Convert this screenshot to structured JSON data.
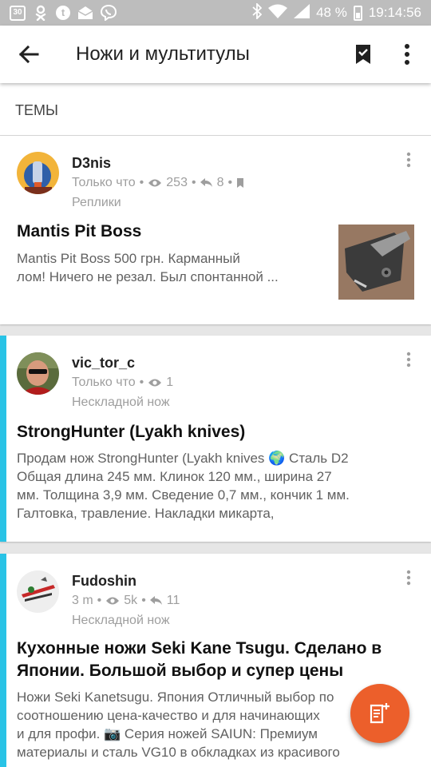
{
  "status_bar": {
    "calendar_day": "30",
    "battery": "48 %",
    "time": "19:14:56",
    "icons": [
      "calendar-icon",
      "ok-icon",
      "t-icon",
      "mail-icon",
      "viber-icon",
      "bluetooth-icon",
      "wifi-icon",
      "signal-icon",
      "battery-icon"
    ]
  },
  "appbar": {
    "title": "Ножи и мультитулы",
    "icons": [
      "back-arrow-icon",
      "bookmark-icon",
      "more-vert-icon"
    ]
  },
  "section": {
    "label": "ТЕМЫ"
  },
  "topics": [
    {
      "author": "D3nis",
      "time": "Только что",
      "views": "253",
      "replies": "8",
      "forum": "Реплики",
      "title": "Mantis Pit Boss",
      "excerpt_lines": [
        "Mantis Pit Boss 500 грн. Карманный",
        "лом! Ничего не резал. Был спонтанной ..."
      ],
      "has_thumbnail": true
    },
    {
      "author": "vic_tor_c",
      "time": "Только что",
      "views": "1",
      "forum": "Нескладной нож",
      "title": "StrongHunter (Lyakh knives)",
      "excerpt_lines": [
        "Продам нож StrongHunter (Lyakh knives 🌍 Сталь D2",
        "Общая длина 245 мм. Клинок 120 мм., ширина 27",
        "мм. Толщина 3,9 мм. Сведение 0,7 мм., кончик 1 мм.",
        "Галтовка, травление. Накладки микарта,"
      ]
    },
    {
      "author": "Fudoshin",
      "time": "3 m",
      "views": "5k",
      "replies": "11",
      "forum": "Нескладной нож",
      "title_lines": [
        "Кухонные ножи Seki Kane Tsugu. Сделано в",
        "Японии. Большой выбор и супер цены"
      ],
      "excerpt_lines": [
        "Ножи Seki Kanetsugu. Япония Отличный выбор по",
        "соотношению цена-качество и для начинающих",
        "и для профи. 📷 Серия ножей SAIUN: Премиум",
        "материалы и сталь VG10 в обкладках из красивого"
      ]
    }
  ],
  "colors": {
    "accent": "#29c3e6",
    "fab": "#ec5f2b",
    "status_bar": "#bdbdbd"
  }
}
